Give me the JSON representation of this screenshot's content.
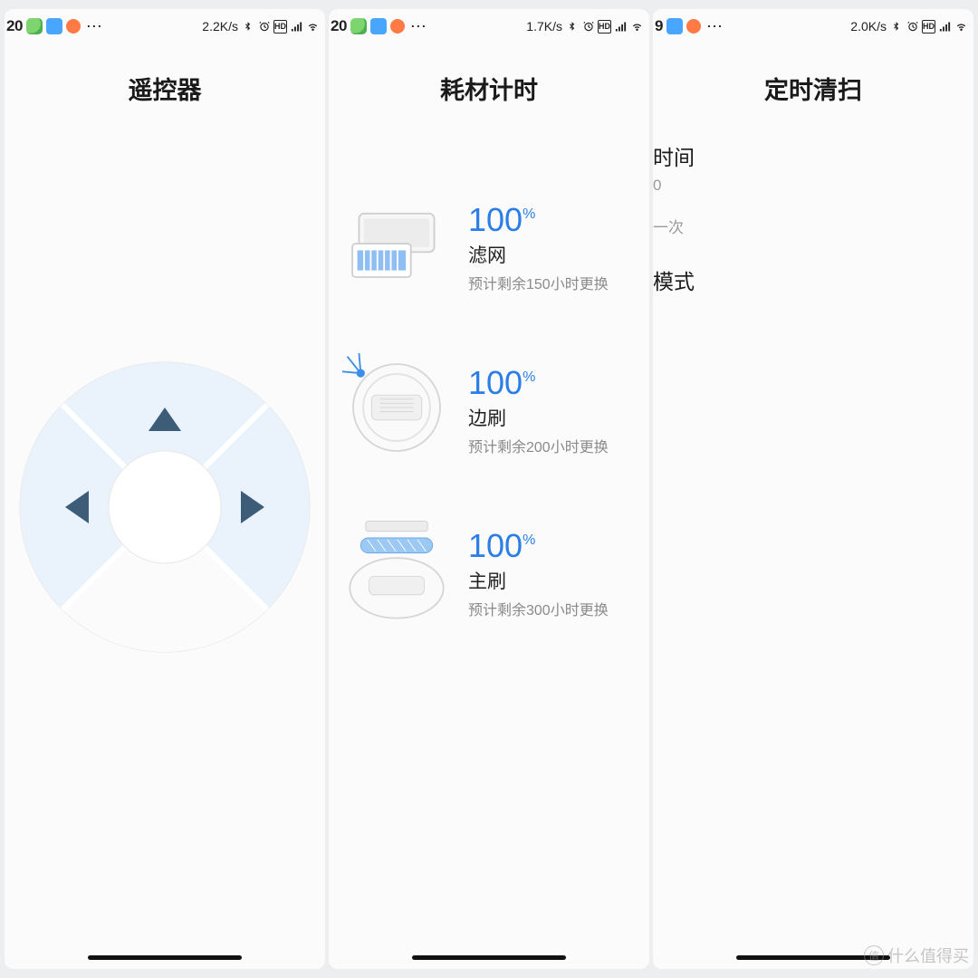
{
  "screens": [
    {
      "status": {
        "time": "20",
        "net": "2.2K/s"
      },
      "title": "遥控器"
    },
    {
      "status": {
        "time": "20",
        "net": "1.7K/s"
      },
      "title": "耗材计时",
      "items": [
        {
          "pct": "100",
          "name": "滤网",
          "sub": "预计剩余150小时更换"
        },
        {
          "pct": "100",
          "name": "边刷",
          "sub": "预计剩余200小时更换"
        },
        {
          "pct": "100",
          "name": "主刷",
          "sub": "预计剩余300小时更换"
        }
      ]
    },
    {
      "status": {
        "time": "9",
        "net": "2.0K/s"
      },
      "title": "定时清扫",
      "rows": [
        {
          "label": "时间",
          "val": "0"
        },
        {
          "label": "",
          "val": "一次"
        },
        {
          "label": "模式",
          "val": ""
        }
      ]
    }
  ],
  "watermark": "什么值得买"
}
